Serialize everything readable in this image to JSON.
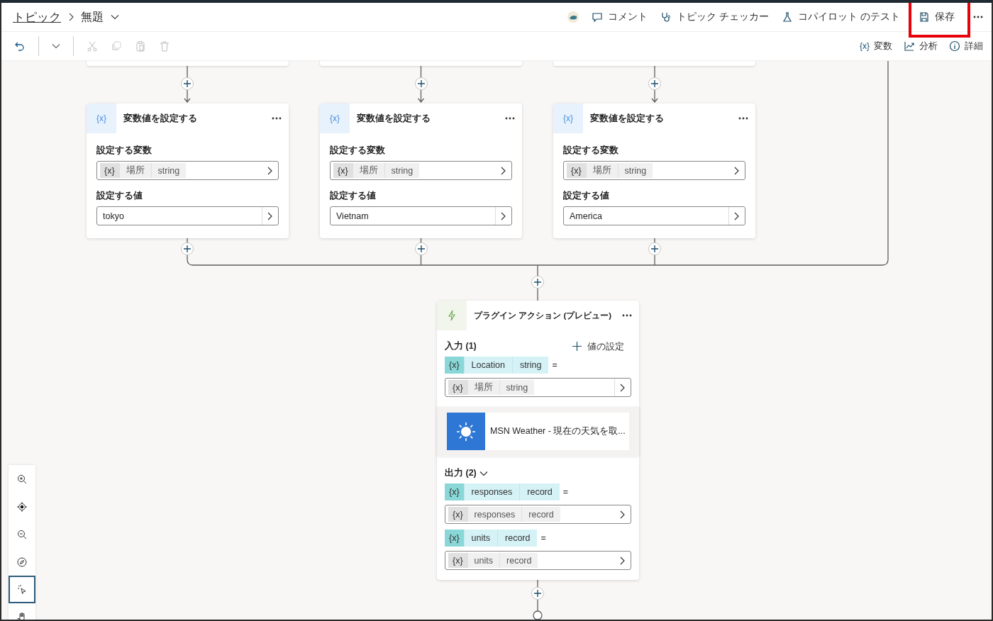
{
  "breadcrumb": {
    "parent": "トピック",
    "current": "無題"
  },
  "header_actions": [
    {
      "kind": "comment",
      "label": "コメント"
    },
    {
      "kind": "checker",
      "label": "トピック チェッカー"
    },
    {
      "kind": "test",
      "label": "コパイロット のテスト"
    }
  ],
  "save": {
    "label": "保存",
    "highlighted": true
  },
  "toolbar_right": [
    {
      "kind": "variable",
      "glyph": "{x}",
      "label": "変数"
    },
    {
      "kind": "analytics",
      "label": "分析"
    },
    {
      "kind": "info",
      "label": "詳細"
    }
  ],
  "set_variable_nodes": [
    {
      "icon_glyph": "{x}",
      "title": "変数値を設定する",
      "variable_label": "設定する変数",
      "variable": {
        "glyph": "{x}",
        "name": "場所",
        "type": "string"
      },
      "value_label": "設定する値",
      "value": "tokyo"
    },
    {
      "icon_glyph": "{x}",
      "title": "変数値を設定する",
      "variable_label": "設定する変数",
      "variable": {
        "glyph": "{x}",
        "name": "場所",
        "type": "string"
      },
      "value_label": "設定する値",
      "value": "Vietnam"
    },
    {
      "icon_glyph": "{x}",
      "title": "変数値を設定する",
      "variable_label": "設定する変数",
      "variable": {
        "glyph": "{x}",
        "name": "場所",
        "type": "string"
      },
      "value_label": "設定する値",
      "value": "America"
    }
  ],
  "plugin_node": {
    "title": "プラグイン アクション (プレビュー)",
    "input_label": "入力 (1)",
    "add_value": "値の設定",
    "inputs": [
      {
        "glyph": "{x}",
        "name": "Location",
        "type": "string",
        "equals": "=",
        "source": {
          "glyph": "{x}",
          "name": "場所",
          "type": "string"
        }
      }
    ],
    "connector": "MSN Weather - 現在の天気を取...",
    "output_label": "出力 (2)",
    "outputs_expanded": true,
    "outputs": [
      {
        "glyph": "{x}",
        "name": "responses",
        "type": "record",
        "equals": "=",
        "target": {
          "glyph": "{x}",
          "name": "responses",
          "type": "record"
        }
      },
      {
        "glyph": "{x}",
        "name": "units",
        "type": "record",
        "equals": "=",
        "target": {
          "glyph": "{x}",
          "name": "units",
          "type": "record"
        }
      }
    ]
  },
  "canvas_tools": [
    {
      "kind": "zoom-in",
      "selected": false
    },
    {
      "kind": "recenter",
      "selected": false
    },
    {
      "kind": "zoom-out",
      "selected": false
    },
    {
      "kind": "minimap",
      "selected": false
    },
    {
      "kind": "select",
      "selected": true
    },
    {
      "kind": "pan",
      "selected": false
    }
  ]
}
